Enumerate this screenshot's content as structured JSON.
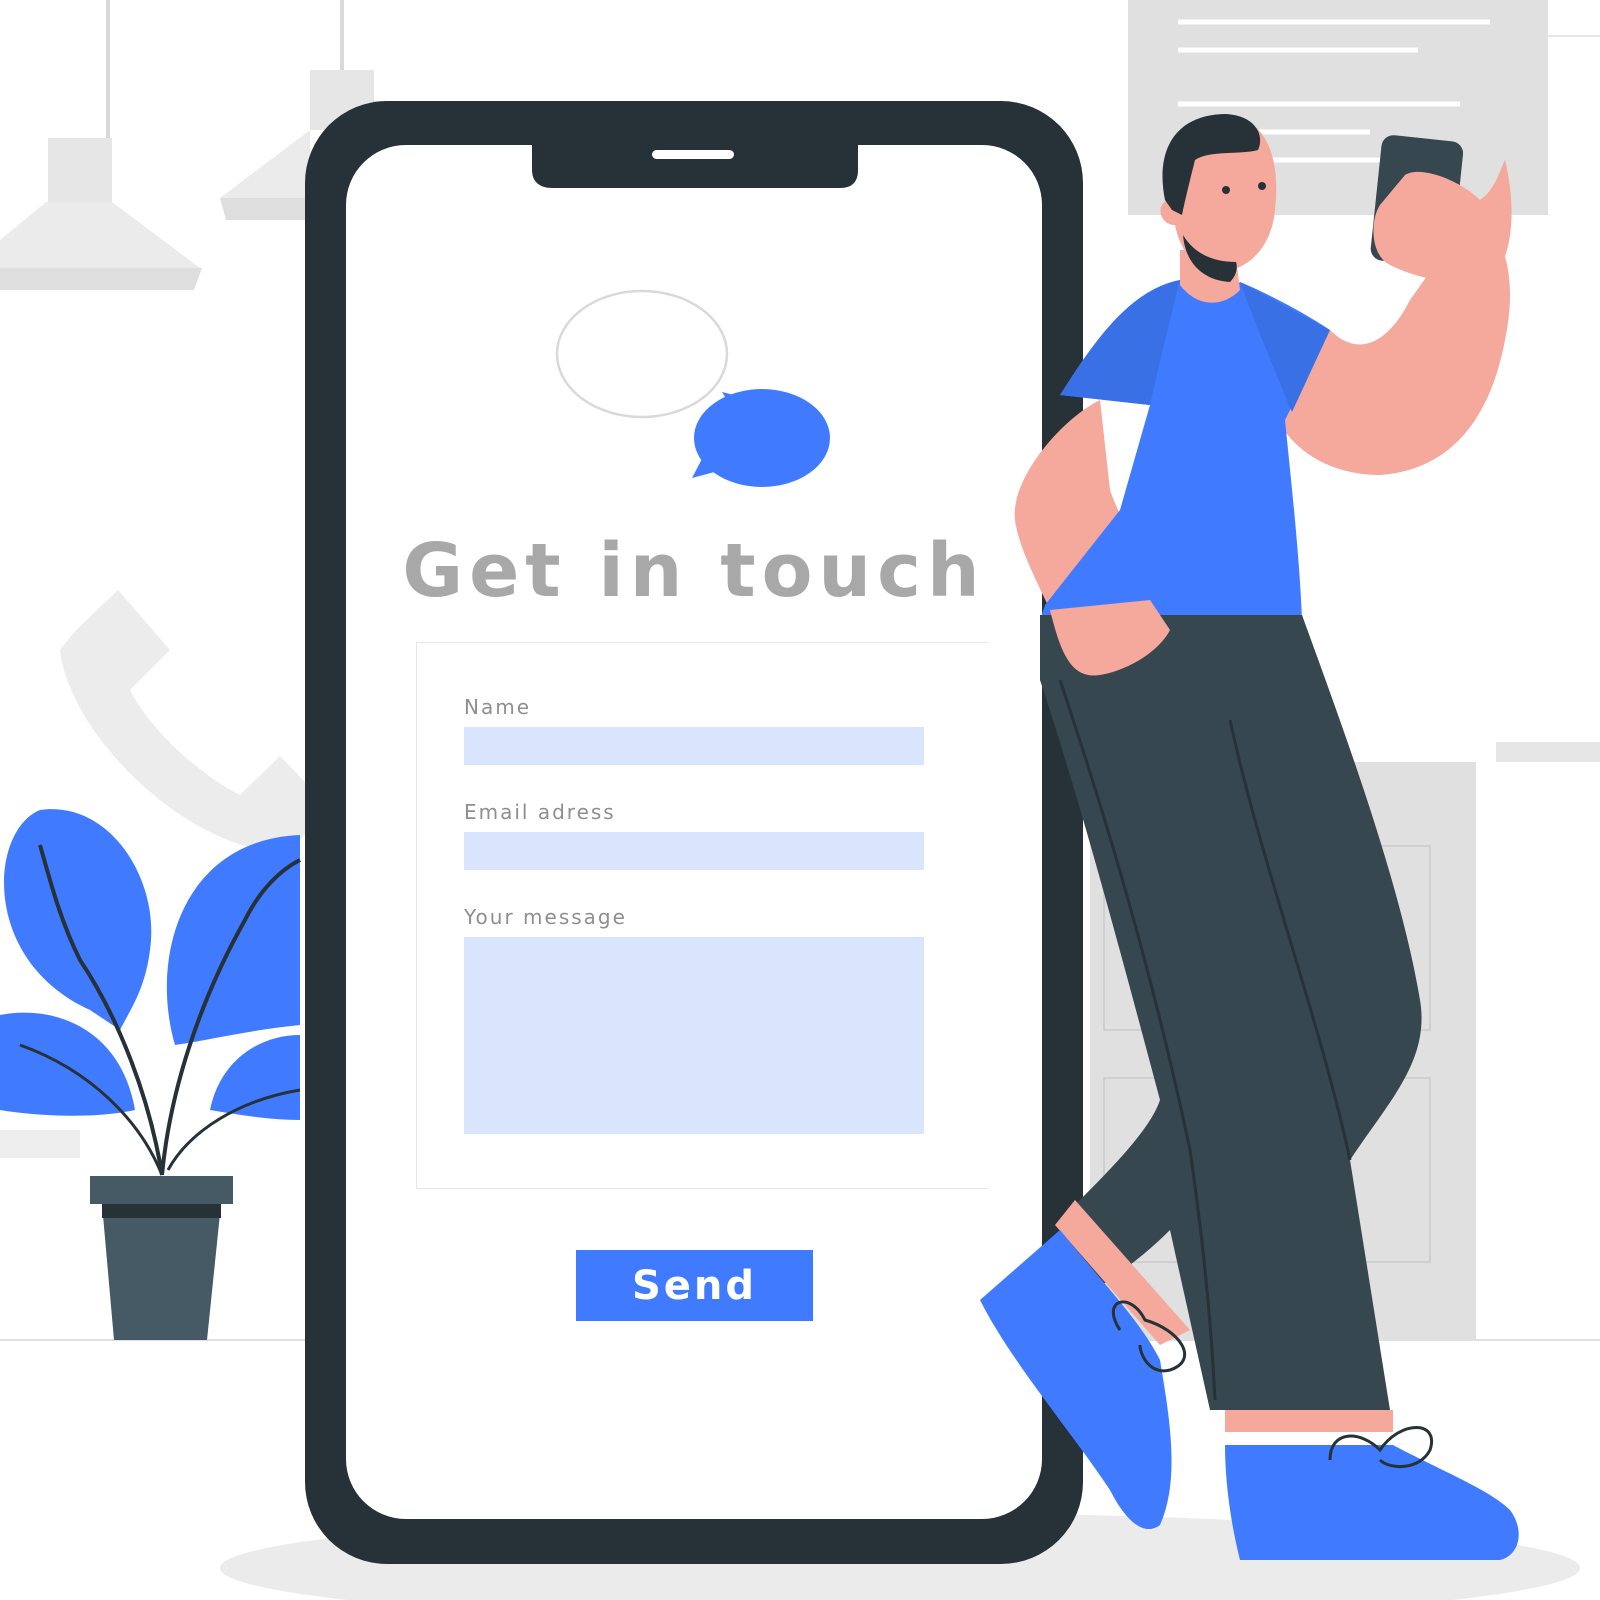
{
  "title": "Get in touch",
  "form": {
    "name_label": "Name",
    "name_value": "",
    "email_label": "Email adress",
    "email_value": "",
    "message_label": "Your message",
    "message_value": "",
    "send_label": "Send"
  },
  "colors": {
    "accent": "#407bff",
    "phone_frame": "#263238",
    "input_fill": "#d9e5fd",
    "skin": "#f5a89c",
    "pants": "#37474f",
    "title_gray": "#a8a8a8"
  },
  "icons": {
    "chat": "speech-bubbles-icon",
    "phone": "telephone-handset-icon",
    "notch": "phone-speaker-notch"
  }
}
